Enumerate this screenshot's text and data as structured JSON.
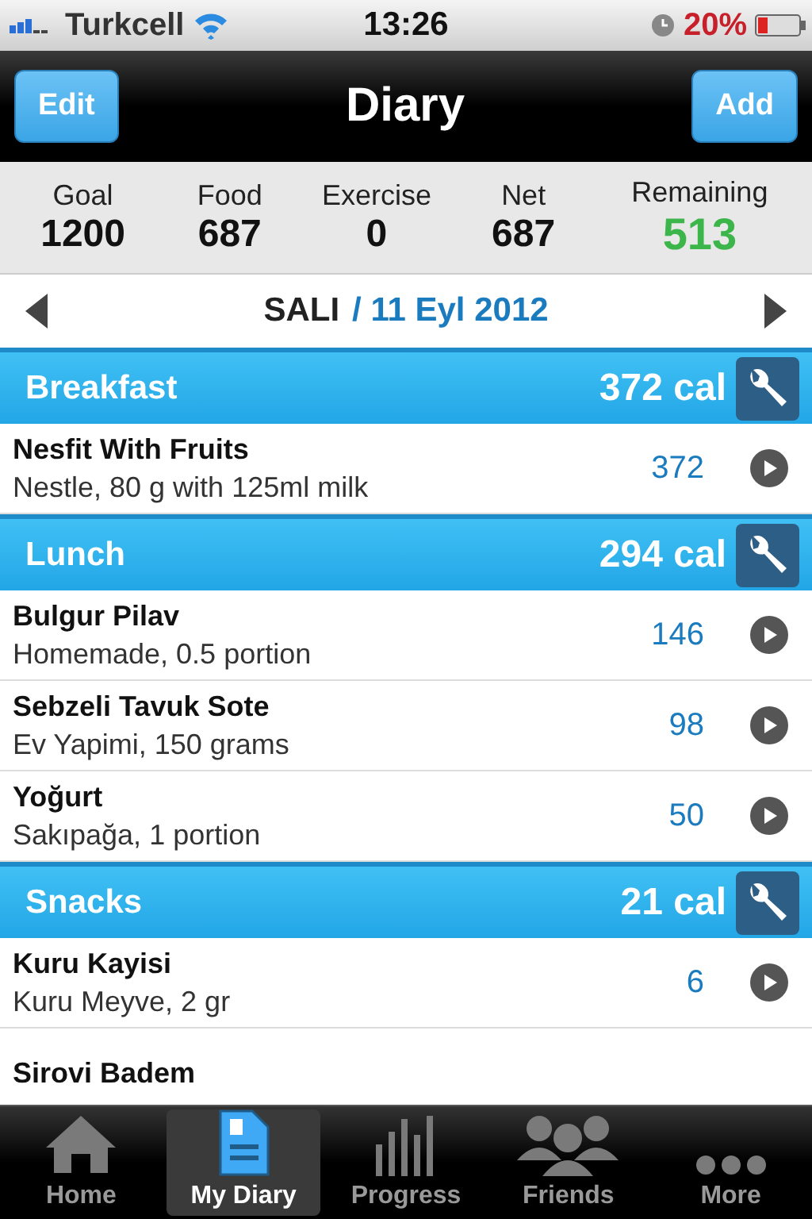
{
  "status_bar": {
    "carrier": "Turkcell",
    "time": "13:26",
    "battery": "20%"
  },
  "nav": {
    "left_button": "Edit",
    "title": "Diary",
    "right_button": "Add"
  },
  "summary": [
    {
      "label": "Goal",
      "value": "1200",
      "kind": "plain"
    },
    {
      "label": "Food",
      "value": "687",
      "kind": "plain"
    },
    {
      "label": "Exercise",
      "value": "0",
      "kind": "plain"
    },
    {
      "label": "Net",
      "value": "687",
      "kind": "plain"
    },
    {
      "label": "Remaining",
      "value": "513",
      "kind": "positive"
    }
  ],
  "date": {
    "day": "SALI",
    "date": "/ 11 Eyl 2012"
  },
  "meals": [
    {
      "name": "Breakfast",
      "calories": "372 cal",
      "items": [
        {
          "name": "Nesfit With Fruits",
          "detail": "Nestle, 80 g with 125ml milk",
          "calories": "372"
        }
      ]
    },
    {
      "name": "Lunch",
      "calories": "294 cal",
      "items": [
        {
          "name": "Bulgur Pilav",
          "detail": "Homemade, 0.5 portion",
          "calories": "146"
        },
        {
          "name": "Sebzeli Tavuk Sote",
          "detail": "Ev Yapimi, 150 grams",
          "calories": "98"
        },
        {
          "name": "Yoğurt",
          "detail": "Sakıpağa, 1 portion",
          "calories": "50"
        }
      ]
    },
    {
      "name": "Snacks",
      "calories": "21 cal",
      "items": [
        {
          "name": "Kuru Kayisi",
          "detail": "Kuru Meyve, 2 gr",
          "calories": "6"
        },
        {
          "name": "Sirovi Badem"
        }
      ]
    }
  ],
  "tabs": [
    {
      "label": "Home",
      "selected": false,
      "kind": "home"
    },
    {
      "label": "My Diary",
      "selected": true,
      "kind": "diary"
    },
    {
      "label": "Progress",
      "selected": false,
      "kind": "progress"
    },
    {
      "label": "Friends",
      "selected": false,
      "kind": "friends"
    },
    {
      "label": "More",
      "selected": false,
      "kind": "more"
    }
  ]
}
